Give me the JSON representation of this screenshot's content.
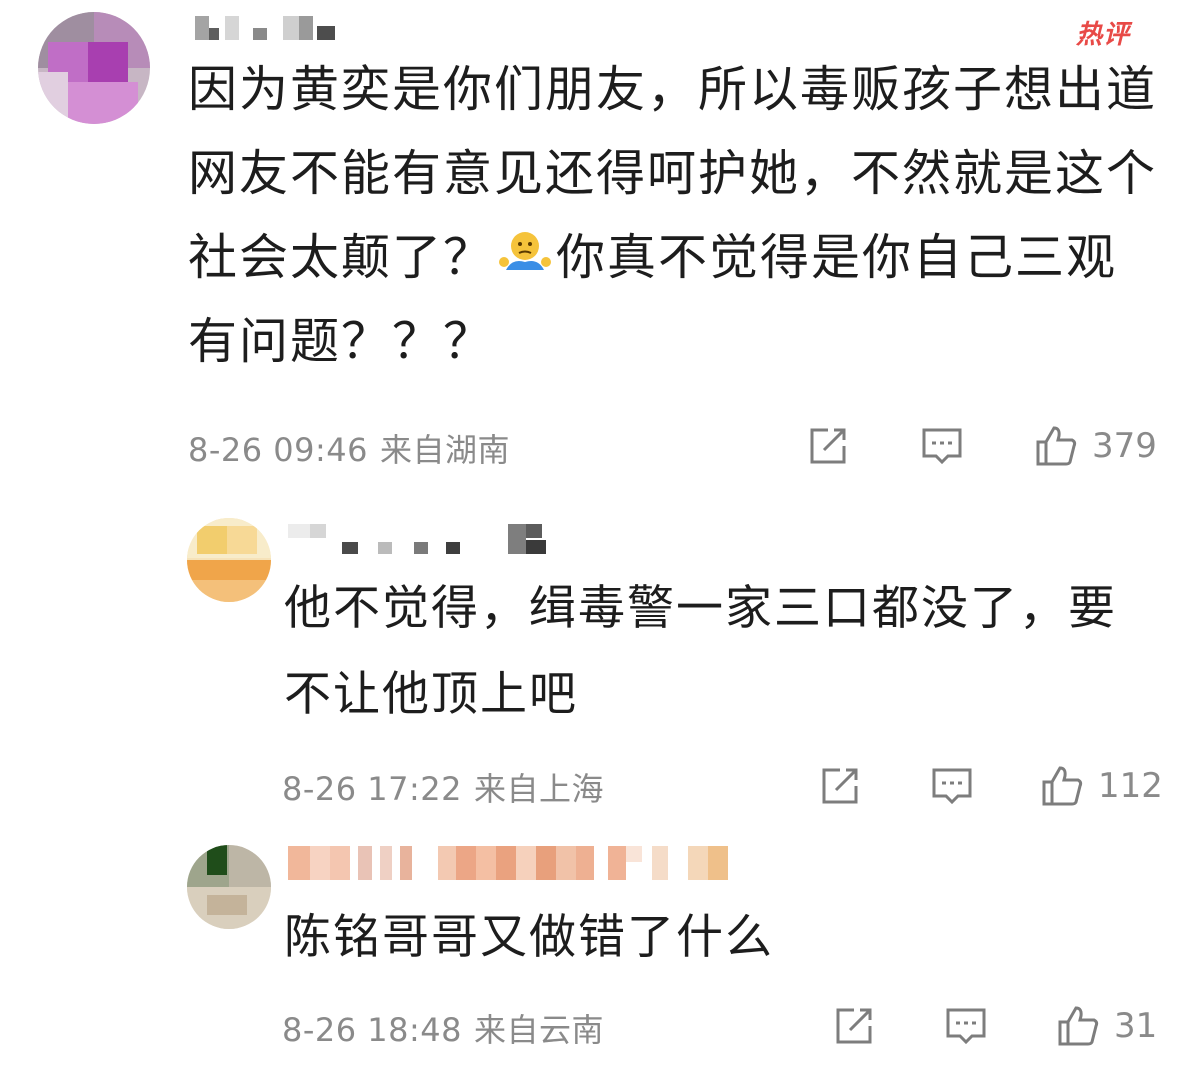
{
  "comments": [
    {
      "badge": "热评",
      "text_before_emoji": "因为黄奕是你们朋友，所以毒贩孩子想出道网友不能有意见还得呵护她，不然就是这个社会太颠了？",
      "emoji": "shrug-emoji",
      "text_after_emoji": "你真不觉得是你自己三观有问题？？？",
      "date": "8-26 09:46",
      "location": "来自湖南",
      "likes": "379"
    },
    {
      "text": "他不觉得，缉毒警一家三口都没了，要不让他顶上吧",
      "date": "8-26 17:22",
      "location": "来自上海",
      "likes": "112"
    },
    {
      "text": "陈铭哥哥又做错了什么",
      "date": "8-26 18:48",
      "location": "来自云南",
      "likes": "31"
    }
  ],
  "colors": {
    "accent_hot": "#e84a47",
    "meta_text": "#8a8a8a",
    "icon_stroke": "#7d7d7d"
  }
}
